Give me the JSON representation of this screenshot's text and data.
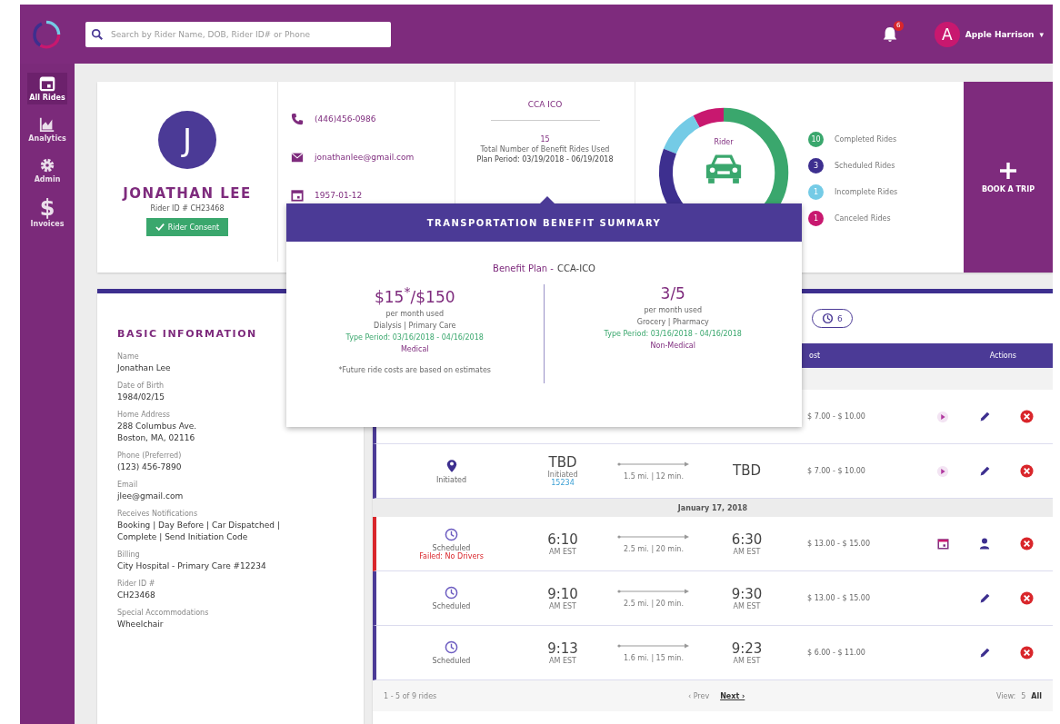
{
  "topbar": {
    "search": {
      "placeholder": "Search by Rider Name, DOB, Rider ID# or Phone"
    },
    "notifications": "6",
    "user": {
      "initial": "A",
      "name": "Apple Harrison",
      "caret": "▾"
    }
  },
  "sidebar": {
    "items": [
      {
        "kind": "calendar",
        "label": "All Rides",
        "selected": true
      },
      {
        "kind": "chart",
        "label": "Analytics",
        "selected": false
      },
      {
        "kind": "gear",
        "label": "Admin",
        "selected": false
      },
      {
        "kind": "dollar",
        "glyph": "$",
        "label": "Invoices",
        "selected": false
      }
    ]
  },
  "profile": {
    "initial": "J",
    "name": "JONATHAN LEE",
    "rider_id": "Rider ID # CH23468",
    "consent": "Rider Consent"
  },
  "contact": [
    {
      "kind": "phone",
      "text": "(446)456-0986"
    },
    {
      "kind": "email",
      "text": "jonathanlee@gmail.com"
    },
    {
      "kind": "calendar",
      "text": "1957-01-12"
    }
  ],
  "plan": {
    "title": "CCA ICO",
    "count": "15",
    "caption": "Total Number of Benefit Rides Used",
    "period": "Plan Period: 03/19/2018 - 06/19/2018"
  },
  "donut": {
    "label": "Rider"
  },
  "legend": [
    {
      "count": "10",
      "label": "Completed Rides",
      "color": "#3aa76d"
    },
    {
      "count": "3",
      "label": "Scheduled Rides",
      "color": "#3d2f8f"
    },
    {
      "count": "1",
      "label": "Incomplete Rides",
      "color": "#74cbe6"
    },
    {
      "count": "1",
      "label": "Canceled Rides",
      "color": "#c8186f"
    }
  ],
  "book_trip": {
    "label": "BOOK A TRIP"
  },
  "basic_info": {
    "title": "BASIC INFORMATION",
    "fields": [
      {
        "label": "Name",
        "value": "Jonathan Lee"
      },
      {
        "label": "Date of Birth",
        "value": "1984/02/15"
      },
      {
        "label": "Home Address",
        "value": "288 Columbus Ave.\nBoston, MA, 02116"
      },
      {
        "label": "Phone (Preferred)",
        "value": "(123) 456-7890"
      },
      {
        "label": "Email",
        "value": "jlee@gmail.com"
      },
      {
        "label": "Receives Notifications",
        "value": "Booking | Day Before | Car Dispatched |\nComplete | Send Initiation Code"
      },
      {
        "label": "Billing",
        "value": "City Hospital - Primary Care #12234"
      },
      {
        "label": "Rider ID #",
        "value": "CH23468"
      },
      {
        "label": "Special Accommodations",
        "value": "Wheelchair"
      }
    ]
  },
  "rides": {
    "filter": {
      "count": "6"
    },
    "columns": [
      "ost",
      "Actions"
    ],
    "rows": [
      {
        "kind": "partial",
        "cost": "$ 7.00 - $ 10.00",
        "alert": false,
        "actions": [
          {
            "kind": "play"
          },
          {
            "kind": "edit"
          },
          {
            "kind": "cancel"
          }
        ]
      },
      {
        "kind": "ride",
        "status": {
          "kind": "initiated",
          "label": "Initiated"
        },
        "pickup": "TBD",
        "pickup_sub": "Initiated",
        "pickup_link": "15234",
        "distance": "1.5 mi. | 12 min.",
        "dropoff": "TBD",
        "cost": "$ 7.00 - $ 10.00",
        "alert": false,
        "actions": [
          {
            "kind": "play"
          },
          {
            "kind": "edit"
          },
          {
            "kind": "cancel"
          }
        ]
      },
      {
        "kind": "date",
        "label": "January 17, 2018"
      },
      {
        "kind": "ride",
        "status": {
          "kind": "scheduled",
          "label": "Scheduled"
        },
        "warning": "Failed: No Drivers",
        "pickup": "6:10",
        "pickup_sub": "AM EST",
        "distance": "2.5 mi. | 20 min.",
        "dropoff": "6:30",
        "dropoff_sub": "AM EST",
        "cost": "$ 13.00 - $ 15.00",
        "alert": true,
        "actions": [
          {
            "kind": "calendar"
          },
          {
            "kind": "driver"
          },
          {
            "kind": "cancel"
          }
        ]
      },
      {
        "kind": "ride",
        "status": {
          "kind": "scheduled",
          "label": "Scheduled"
        },
        "pickup": "9:10",
        "pickup_sub": "AM EST",
        "distance": "2.5 mi. | 20 min.",
        "dropoff": "9:30",
        "dropoff_sub": "AM EST",
        "cost": "$ 13.00 - $ 15.00",
        "alert": false,
        "actions": [
          {
            "kind": "edit"
          },
          {
            "kind": "cancel"
          }
        ]
      },
      {
        "kind": "ride",
        "status": {
          "kind": "scheduled",
          "label": "Scheduled"
        },
        "pickup": "9:13",
        "pickup_sub": "AM EST",
        "distance": "1.6 mi. | 15 min.",
        "dropoff": "9:23",
        "dropoff_sub": "AM EST",
        "cost": "$ 6.00 - $ 11.00",
        "alert": false,
        "actions": [
          {
            "kind": "edit"
          },
          {
            "kind": "cancel"
          }
        ]
      }
    ],
    "footer": {
      "range": "1 - 5 of 9 rides",
      "prev": "‹ Prev",
      "next": "Next ›",
      "view_label": "View:",
      "view_options": [
        {
          "label": "5",
          "selected": false
        },
        {
          "label": "All",
          "selected": true
        }
      ]
    }
  },
  "popover": {
    "title": "TRANSPORTATION BENEFIT SUMMARY",
    "plan_label": "Benefit Plan -",
    "plan_value": "CCA-ICO",
    "columns": [
      {
        "amount": "$15$^{*}$/$150",
        "sub": "per month used",
        "types": "Dialysis | Primary Care",
        "period": "Type Period: 03/16/2018 - 04/16/2018",
        "category": "Medical",
        "note": "*Future ride costs are based on estimates"
      },
      {
        "amount": "3/5",
        "sub": "per month used",
        "types": "Grocery | Pharmacy",
        "period": "Type Period: 03/16/2018 - 04/16/2018",
        "category": "Non-Medical"
      }
    ]
  }
}
